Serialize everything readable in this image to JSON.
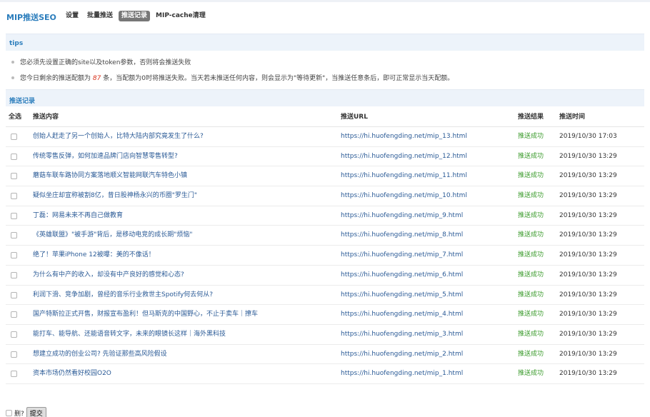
{
  "app_title": "MIP推送SEO",
  "nav": [
    {
      "label": "设置"
    },
    {
      "label": "批量推送"
    },
    {
      "label": "推送记录"
    },
    {
      "label": "MIP-cache清理"
    }
  ],
  "tips": {
    "title": "tips",
    "line1": "您必须先设置正确的site以及token参数，否则将会推送失败",
    "line2_before": "您今日剩余的推送配额为",
    "quota": "87",
    "line2_after": "条，当配额为0时将推送失败。当天若未推送任何内容，则会显示为\"等待更新\"，当推送任意条后，即可正常显示当天配额。"
  },
  "records": {
    "title": "推送记录",
    "headers": {
      "select": "全选",
      "content": "推送内容",
      "url": "推送URL",
      "result": "推送结果",
      "time": "推送时间"
    },
    "rows": [
      {
        "content": "创始人赶走了另一个创始人，比特大陆内部究竟发生了什么?",
        "url": "https://hi.huofengding.net/mip_13.html",
        "result": "推送成功",
        "time": "2019/10/30 17:03"
      },
      {
        "content": "传统零售反弹，如何加速品牌门店向智慧零售转型?",
        "url": "https://hi.huofengding.net/mip_12.html",
        "result": "推送成功",
        "time": "2019/10/30 13:29"
      },
      {
        "content": "蘑菇车联车路协同方案落地顺义智能网联汽车特色小镇",
        "url": "https://hi.huofengding.net/mip_11.html",
        "result": "推送成功",
        "time": "2019/10/30 13:29"
      },
      {
        "content": "疑似坐庄却宣称被割8亿，昔日股神杨永兴的币圈\"罗生门\"",
        "url": "https://hi.huofengding.net/mip_10.html",
        "result": "推送成功",
        "time": "2019/10/30 13:29"
      },
      {
        "content": "丁磊：网易未来不再自己做教育",
        "url": "https://hi.huofengding.net/mip_9.html",
        "result": "推送成功",
        "time": "2019/10/30 13:29"
      },
      {
        "content": "《英雄联盟》\"被手游\"背后，是移动电竞的成长期\"烦恼\"",
        "url": "https://hi.huofengding.net/mip_8.html",
        "result": "推送成功",
        "time": "2019/10/30 13:29"
      },
      {
        "content": "绝了！苹果iPhone 12被曝：美的不像话！",
        "url": "https://hi.huofengding.net/mip_7.html",
        "result": "推送成功",
        "time": "2019/10/30 13:29"
      },
      {
        "content": "为什么有中产的收入，却没有中产良好的感觉和心态?",
        "url": "https://hi.huofengding.net/mip_6.html",
        "result": "推送成功",
        "time": "2019/10/30 13:29"
      },
      {
        "content": "利润下滑、竞争加剧，曾经的音乐行业救世主Spotify何去何从?",
        "url": "https://hi.huofengding.net/mip_5.html",
        "result": "推送成功",
        "time": "2019/10/30 13:29"
      },
      {
        "content": "国产特斯拉正式开售，财报宣布盈利！但马斯克的中国野心，不止于卖车｜撩车",
        "url": "https://hi.huofengding.net/mip_4.html",
        "result": "推送成功",
        "time": "2019/10/30 13:29"
      },
      {
        "content": "能打车、能导航、还能语音转文字，未来的眼镜长这样｜海外黑科技",
        "url": "https://hi.huofengding.net/mip_3.html",
        "result": "推送成功",
        "time": "2019/10/30 13:29"
      },
      {
        "content": "想建立成功的创业公司? 先验证那些高风险假设",
        "url": "https://hi.huofengding.net/mip_2.html",
        "result": "推送成功",
        "time": "2019/10/30 13:29"
      },
      {
        "content": "资本市场仍然看好校园O2O",
        "url": "https://hi.huofengding.net/mip_1.html",
        "result": "推送成功",
        "time": "2019/10/30 13:29"
      }
    ]
  },
  "footer": {
    "delete_label": "删?",
    "submit_label": "提交"
  }
}
